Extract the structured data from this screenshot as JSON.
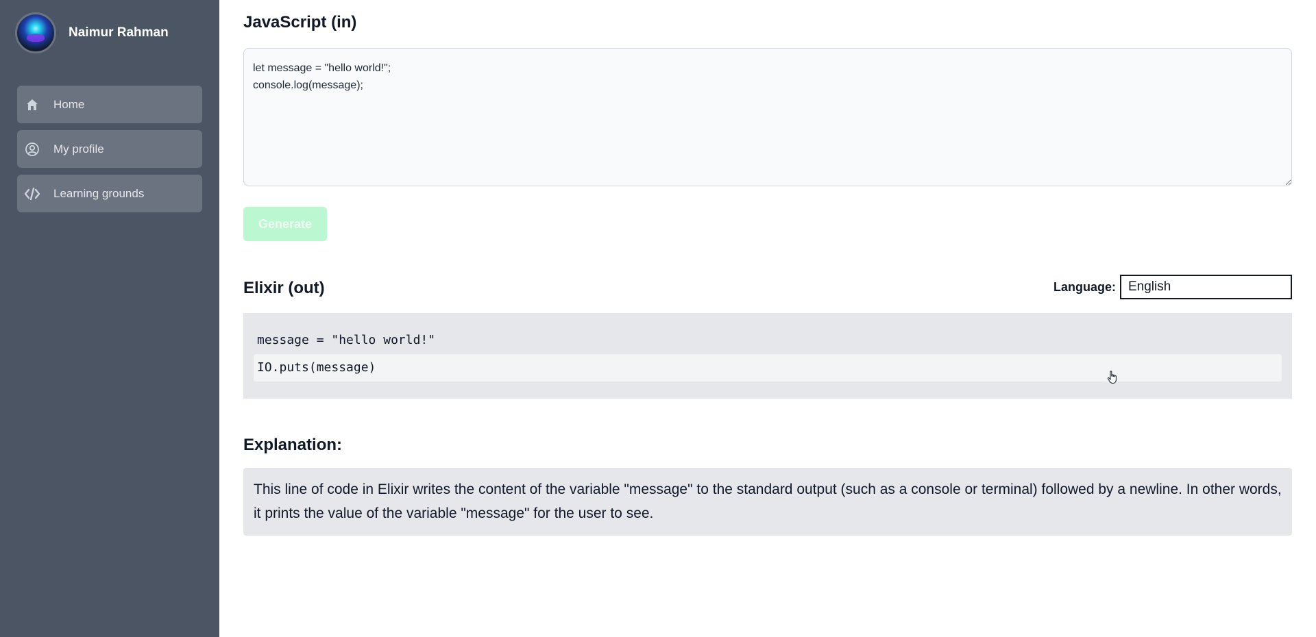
{
  "profile": {
    "name": "Naimur Rahman"
  },
  "nav": {
    "items": [
      {
        "label": "Home",
        "icon": "home-icon"
      },
      {
        "label": "My profile",
        "icon": "user-circle-icon"
      },
      {
        "label": "Learning grounds",
        "icon": "code-icon"
      }
    ]
  },
  "input": {
    "title": "JavaScript (in)",
    "code": "let message = \"hello world!\";\nconsole.log(message);"
  },
  "generate_label": "Generate",
  "output": {
    "title": "Elixir (out)",
    "language_label": "Language:",
    "language_value": "English",
    "lines": [
      "message = \"hello world!\"",
      "IO.puts(message)"
    ]
  },
  "explanation": {
    "title": "Explanation:",
    "text": "This line of code in Elixir writes the content of the variable \"message\" to the standard output (such as a console or terminal) followed by a newline. In other words, it prints the value of the variable \"message\" for the user to see."
  },
  "colors": {
    "sidebar": "#4b5563",
    "nav_item": "#6b7280",
    "generate_button": "#bbf7d0",
    "output_bg": "#e5e7eb"
  }
}
